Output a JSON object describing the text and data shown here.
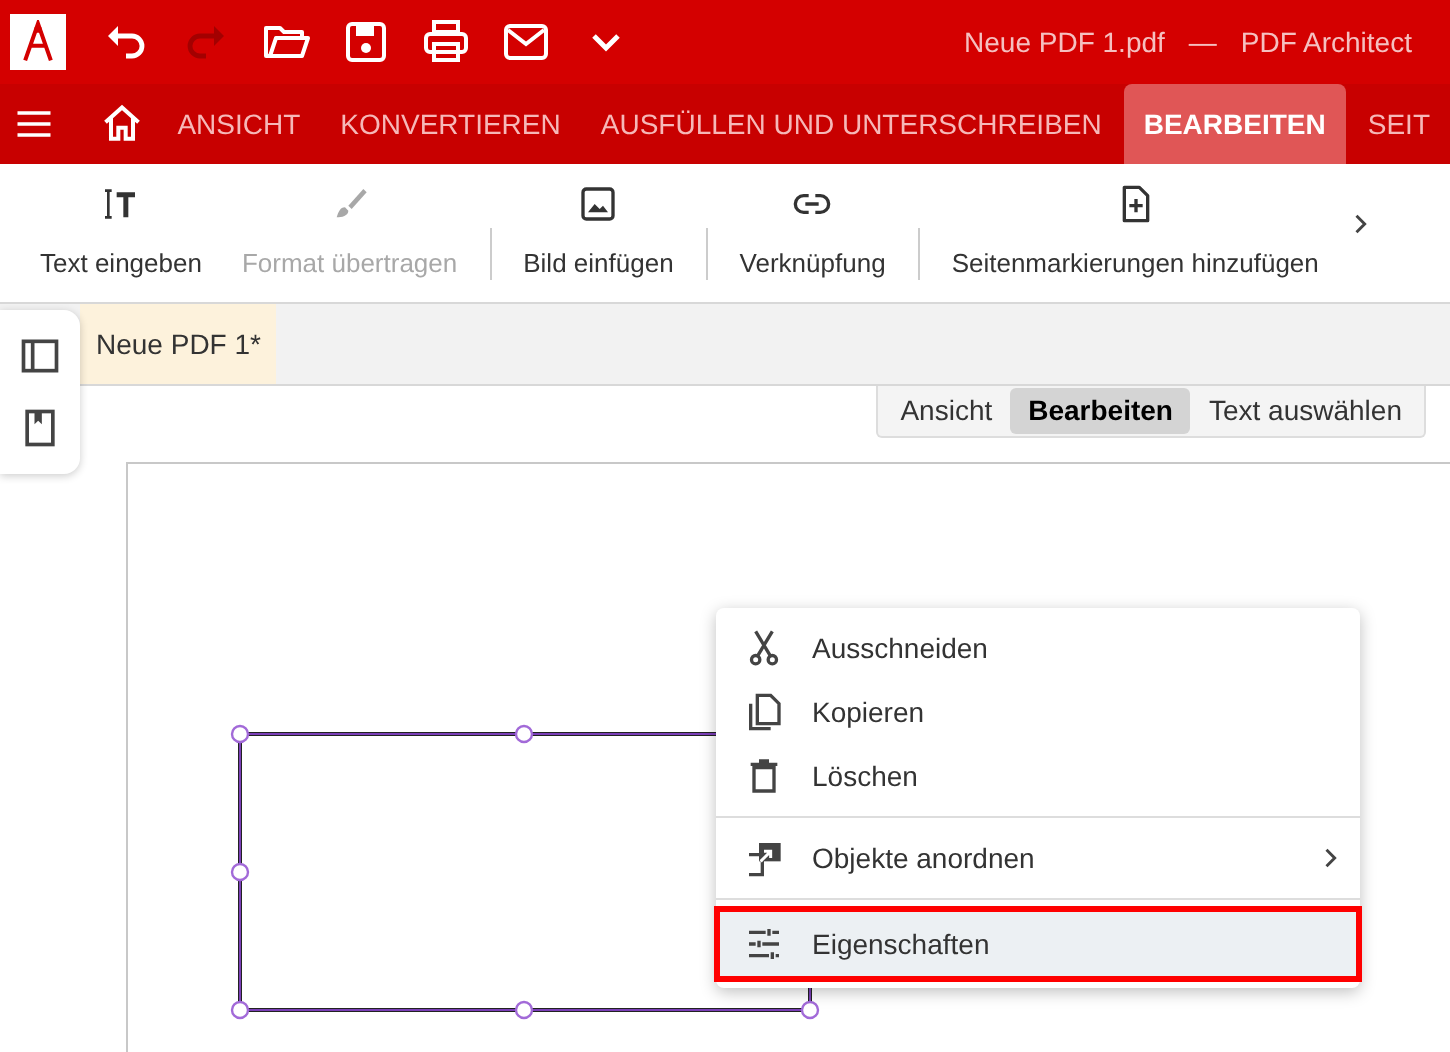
{
  "window": {
    "title": "Neue PDF 1.pdf",
    "separator": "—",
    "app_name": "PDF Architect"
  },
  "quick_access": [
    {
      "disabled": false
    },
    {
      "disabled": true
    },
    {
      "disabled": false
    },
    {
      "disabled": false
    },
    {
      "disabled": false
    },
    {
      "disabled": false
    },
    {
      "disabled": false
    }
  ],
  "ribbon_tabs": [
    {
      "label": "ANSICHT",
      "selected": false
    },
    {
      "label": "KONVERTIEREN",
      "selected": false
    },
    {
      "label": "AUSFÜLLEN UND UNTERSCHREIBEN",
      "selected": false
    },
    {
      "label": "BEARBEITEN",
      "selected": true
    },
    {
      "label": "SEIT",
      "selected": false
    }
  ],
  "toolbar": [
    {
      "label": "Text eingeben",
      "disabled": false,
      "divider_after": false
    },
    {
      "label": "Format übertragen",
      "disabled": true,
      "divider_after": true
    },
    {
      "label": "Bild einfügen",
      "disabled": false,
      "divider_after": true
    },
    {
      "label": "Verknüpfung",
      "disabled": false,
      "divider_after": true
    },
    {
      "label": "Seitenmarkierungen hinzufügen",
      "disabled": false,
      "divider_after": false
    }
  ],
  "document_tabs": [
    {
      "label": "Neue PDF 1*",
      "selected": true
    }
  ],
  "mode_switch": [
    {
      "label": "Ansicht",
      "selected": false
    },
    {
      "label": "Bearbeiten",
      "selected": true
    },
    {
      "label": "Text auswählen",
      "selected": false
    }
  ],
  "context_menu": [
    {
      "label": "Ausschneiden",
      "kind": "item",
      "highlighted": false,
      "divider_after": false
    },
    {
      "label": "Kopieren",
      "kind": "item",
      "highlighted": false,
      "divider_after": false
    },
    {
      "label": "Löschen",
      "kind": "item",
      "highlighted": false,
      "divider_after": true
    },
    {
      "label": "Objekte anordnen",
      "kind": "submenu",
      "highlighted": false,
      "divider_after": true
    },
    {
      "label": "Eigenschaften",
      "kind": "item",
      "highlighted": true,
      "divider_after": false
    }
  ]
}
